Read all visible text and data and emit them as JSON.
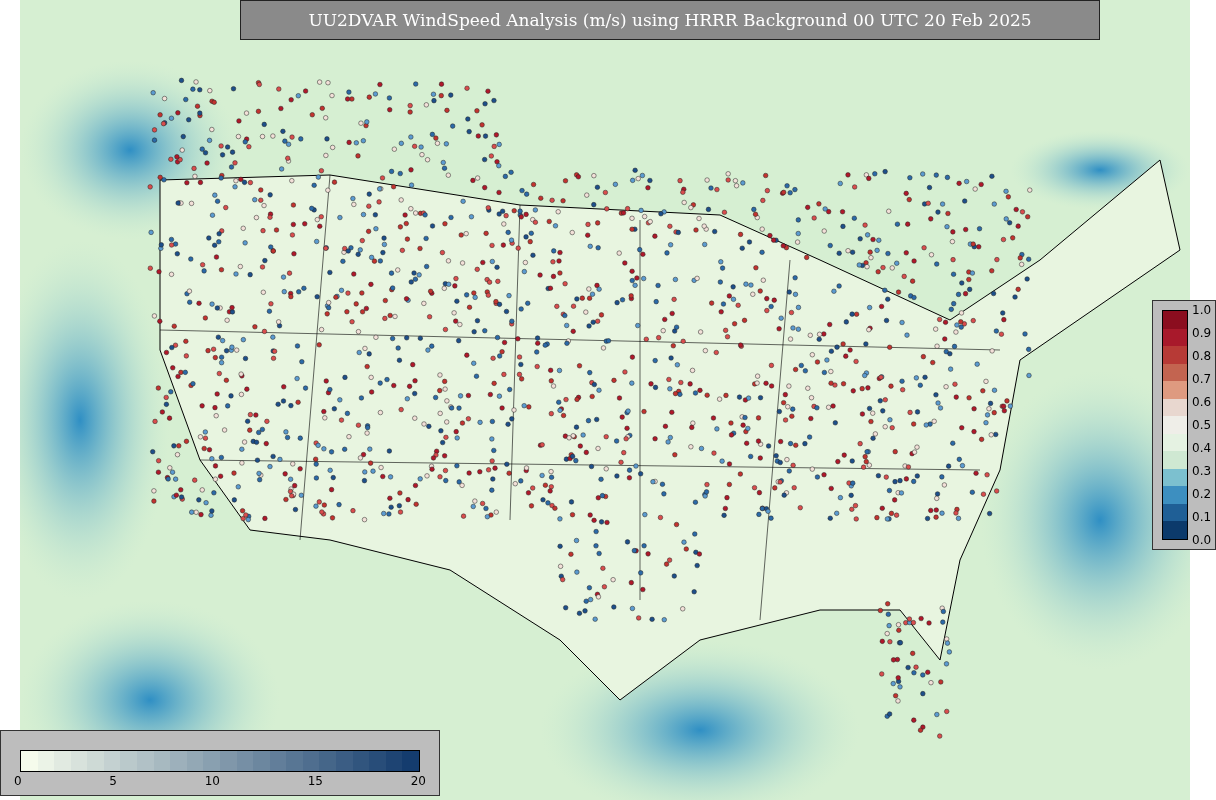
{
  "title": "UU2DVAR WindSpeed Analysis (m/s) using HRRR Background 00 UTC 20 Feb 2025",
  "ratio_colorbar": {
    "ticks": [
      "1.0",
      "0.9",
      "0.8",
      "0.7",
      "0.6",
      "0.5",
      "0.4",
      "0.3",
      "0.2",
      "0.1",
      "0.0"
    ]
  },
  "speed_colorbar": {
    "ticks": [
      "0",
      "5",
      "10",
      "15",
      "20"
    ]
  }
}
